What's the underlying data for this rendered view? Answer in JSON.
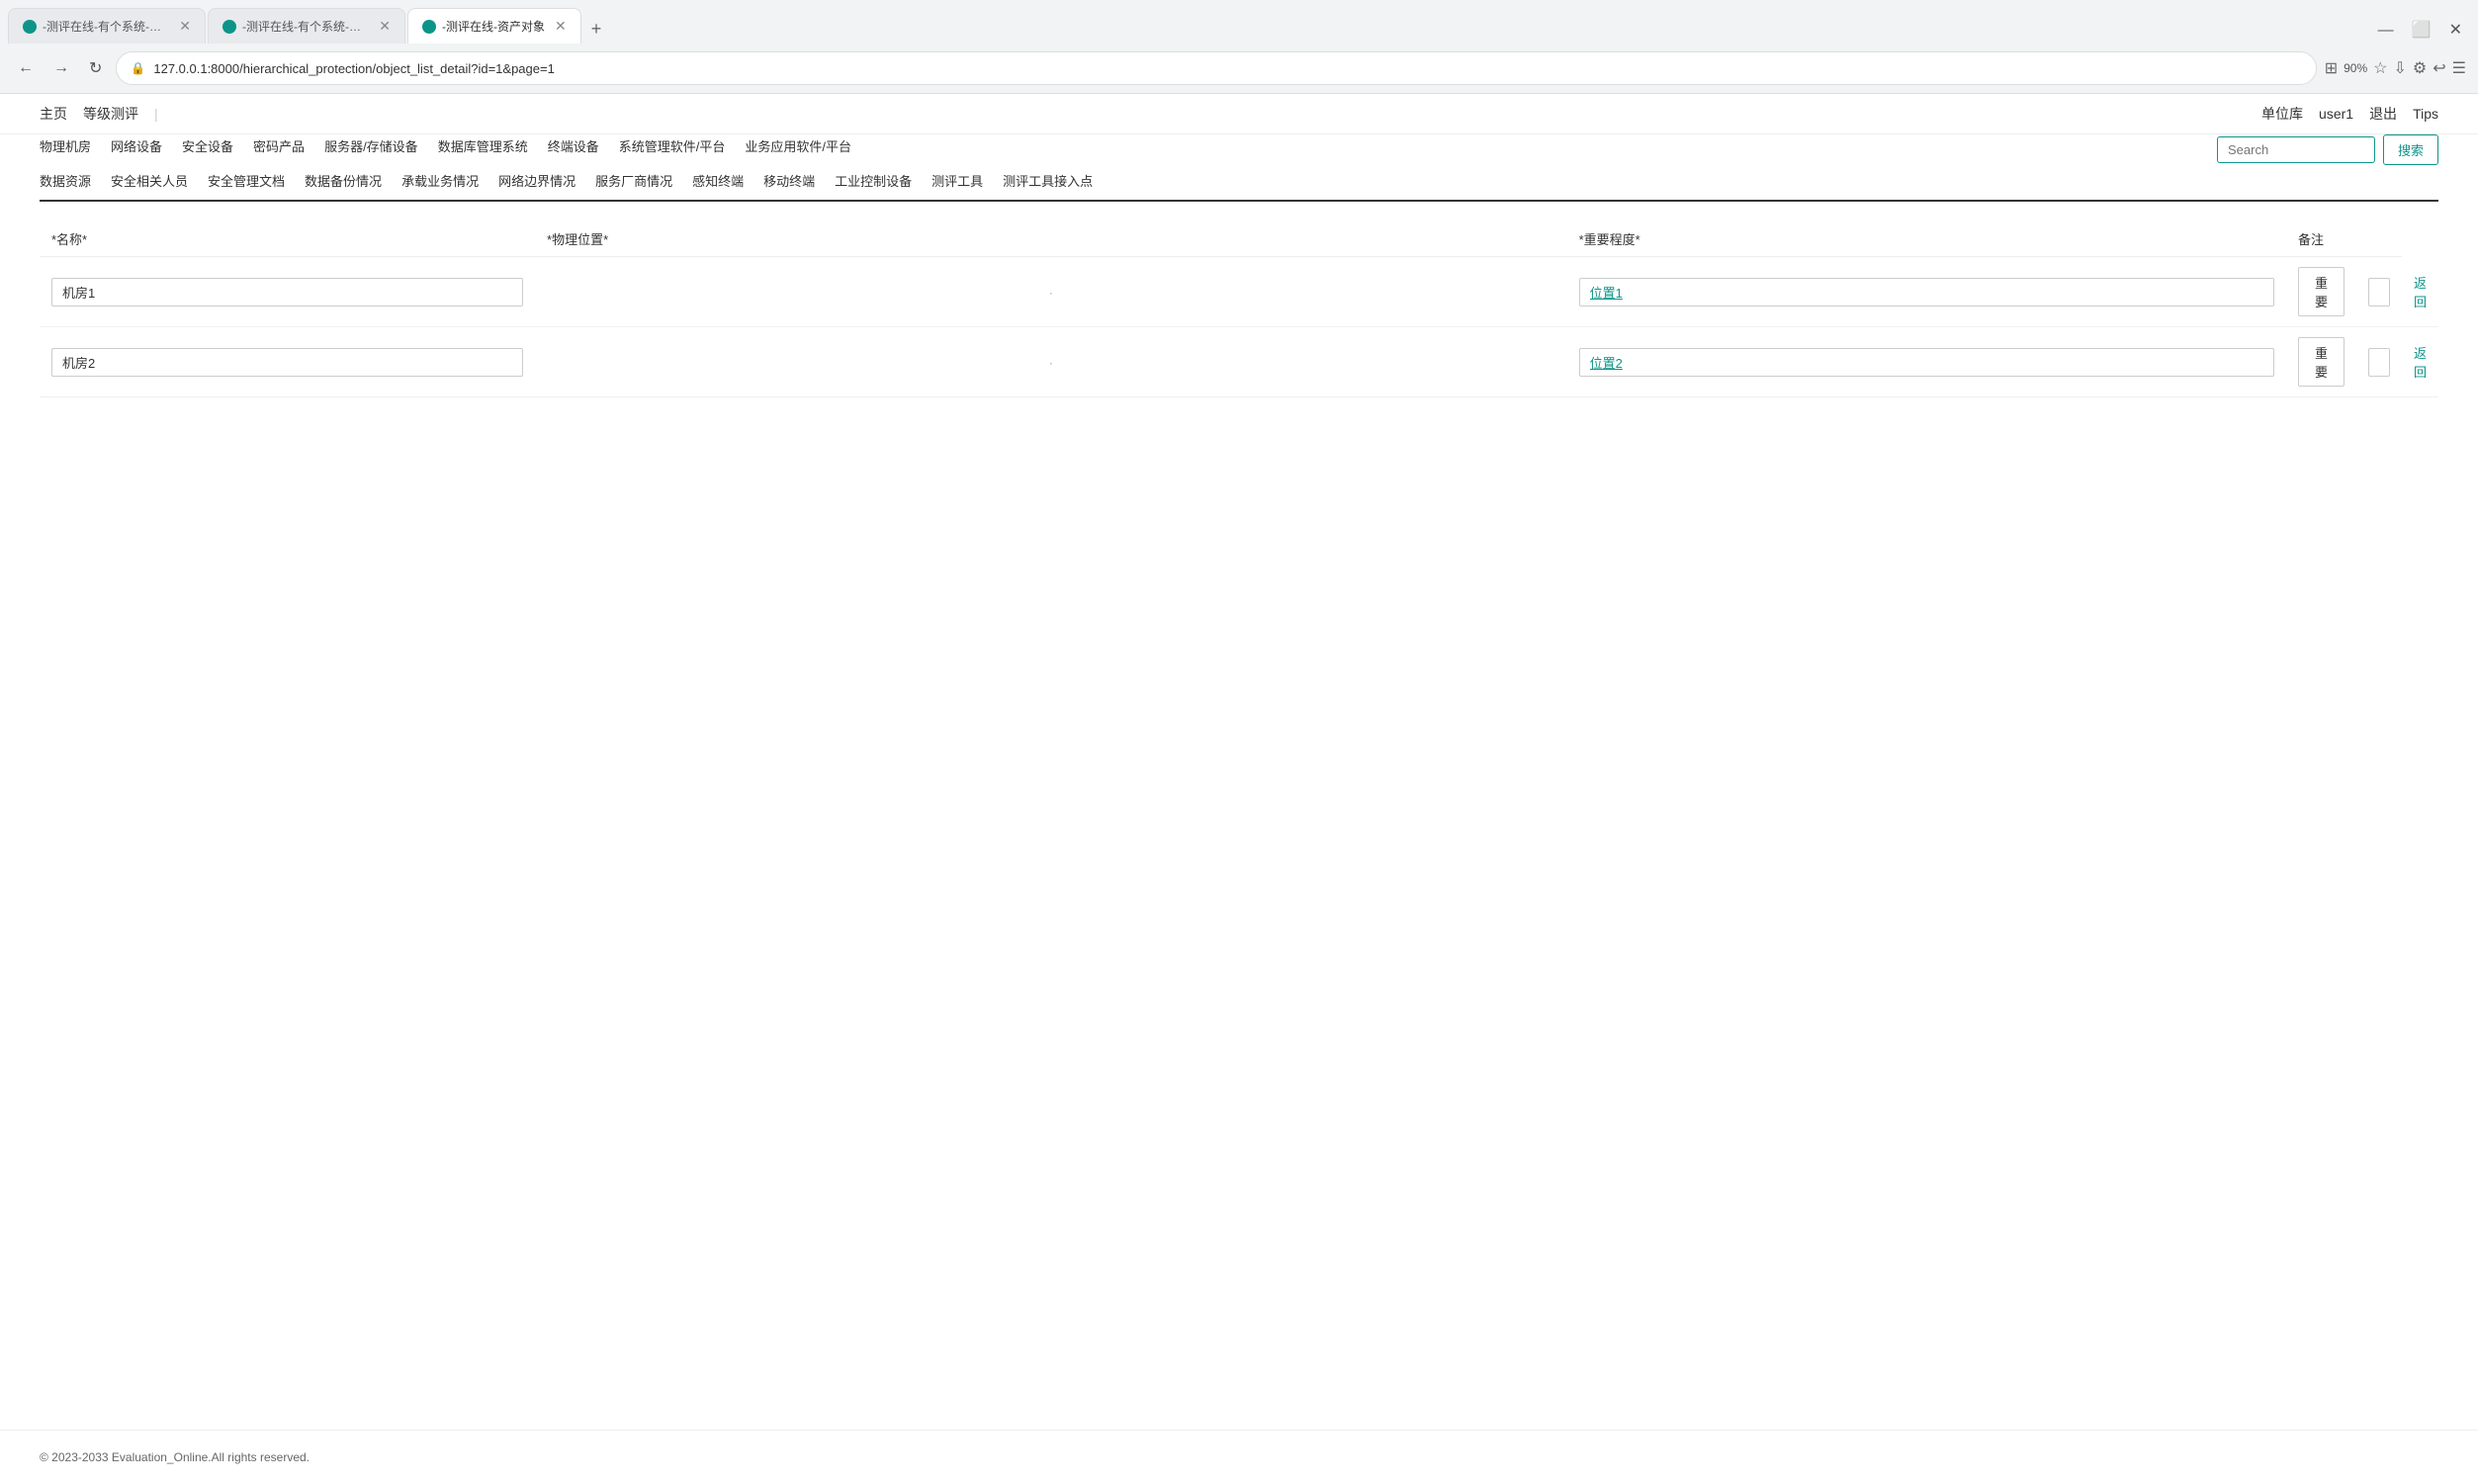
{
  "browser": {
    "tabs": [
      {
        "id": 1,
        "title": "-测评在线-有个系统-资产对象",
        "active": false,
        "icon": "teal"
      },
      {
        "id": 2,
        "title": "-测评在线-有个系统-资产对象",
        "active": false,
        "icon": "teal"
      },
      {
        "id": 3,
        "title": "-测评在线-资产对象",
        "active": true,
        "icon": "teal"
      }
    ],
    "url": "127.0.0.1:8000/hierarchical_protection/object_list_detail?id=1&page=1",
    "zoom": "90%"
  },
  "topnav": {
    "left": [
      {
        "label": "主页",
        "key": "home"
      },
      {
        "label": "等级测评",
        "key": "evaluation"
      }
    ],
    "right": [
      {
        "label": "单位库",
        "key": "unit-library"
      },
      {
        "label": "user1",
        "key": "user"
      },
      {
        "label": "退出",
        "key": "logout"
      },
      {
        "label": "Tips",
        "key": "tips"
      }
    ]
  },
  "categorynav": {
    "row1": [
      "物理机房",
      "网络设备",
      "安全设备",
      "密码产品",
      "服务器/存储设备",
      "数据库管理系统",
      "终端设备",
      "系统管理软件/平台",
      "业务应用软件/平台"
    ],
    "row2": [
      "数据资源",
      "安全相关人员",
      "安全管理文档",
      "数据备份情况",
      "承载业务情况",
      "网络边界情况",
      "服务厂商情况",
      "感知终端",
      "移动终端",
      "工业控制设备",
      "测评工具",
      "测评工具接入点"
    ]
  },
  "search": {
    "placeholder": "Search",
    "button_label": "搜索"
  },
  "table": {
    "headers": {
      "name": "*名称*",
      "location": "*物理位置*",
      "importance": "*重要程度*",
      "note": "备注",
      "action": ""
    },
    "rows": [
      {
        "name": "机房1",
        "location": "位置1",
        "importance": "重要",
        "note": "",
        "action": "返回"
      },
      {
        "name": "机房2",
        "location": "位置2",
        "importance": "重要",
        "note": "",
        "action": "返回"
      }
    ]
  },
  "footer": {
    "text": "© 2023-2033 Evaluation_Online.All rights reserved."
  }
}
